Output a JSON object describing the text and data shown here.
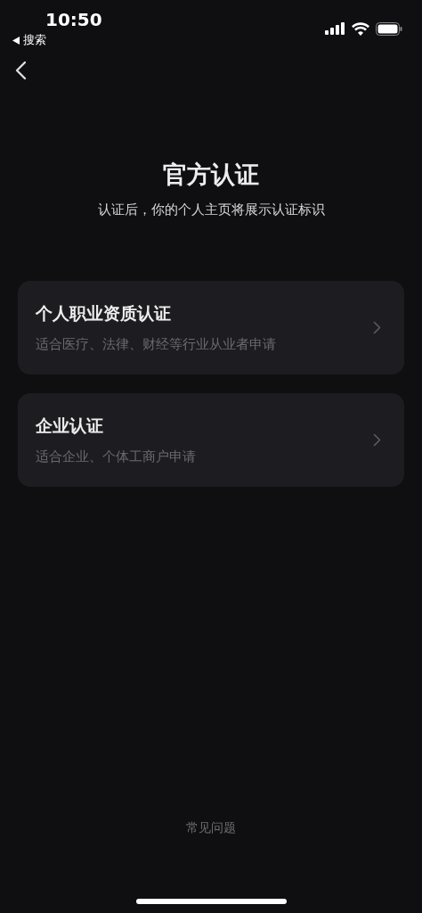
{
  "status_bar": {
    "time": "10:50",
    "back_app": "搜索"
  },
  "title": "官方认证",
  "subtitle": "认证后，你的个人主页将展示认证标识",
  "options": [
    {
      "title": "个人职业资质认证",
      "description": "适合医疗、法律、财经等行业从业者申请"
    },
    {
      "title": "企业认证",
      "description": "适合企业、个体工商户申请"
    }
  ],
  "footer_link": "常见问题"
}
